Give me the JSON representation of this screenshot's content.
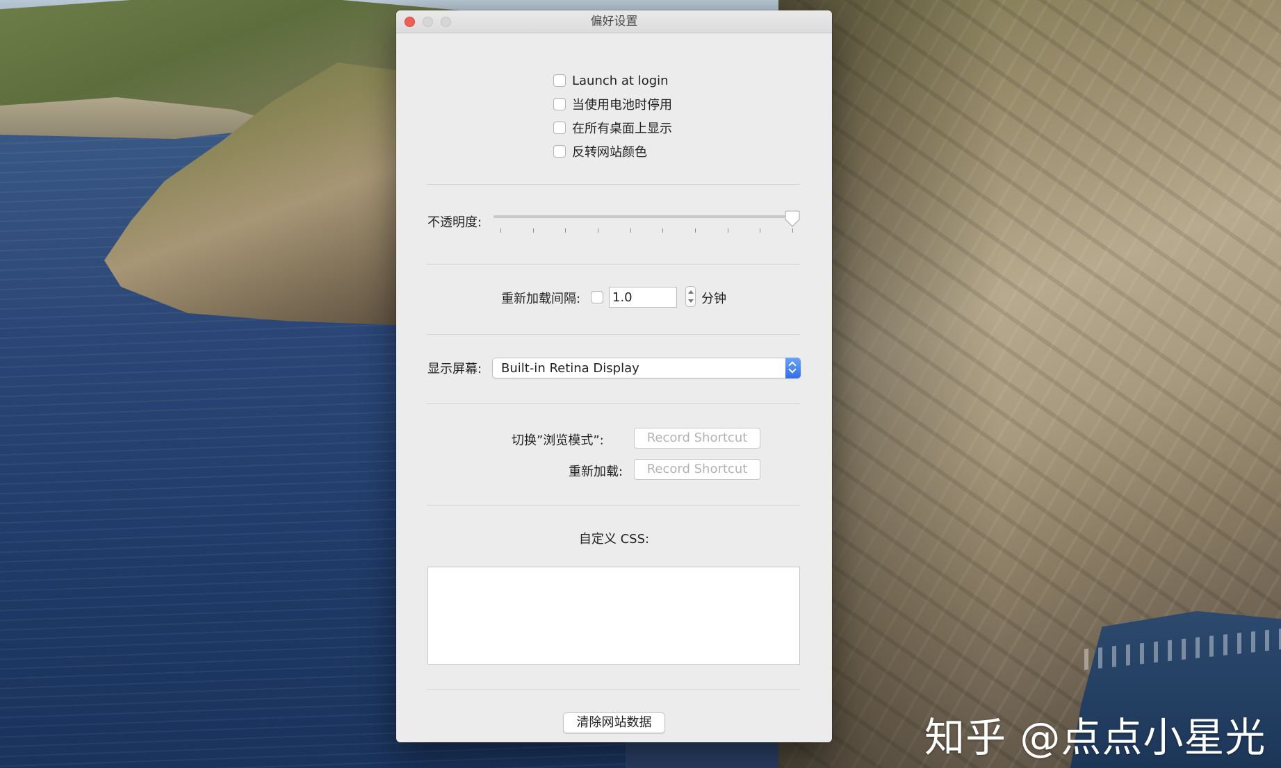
{
  "window": {
    "title": "偏好设置"
  },
  "general": {
    "checkboxes": [
      {
        "label": "Launch at login",
        "checked": false
      },
      {
        "label": "当使用电池时停用",
        "checked": false
      },
      {
        "label": "在所有桌面上显示",
        "checked": false
      },
      {
        "label": "反转网站颜色",
        "checked": false
      }
    ]
  },
  "opacity": {
    "label": "不透明度:",
    "value": 1.0,
    "tick_count": 10
  },
  "reload_interval": {
    "label": "重新加载间隔:",
    "enabled": false,
    "value": "1.0",
    "unit": "分钟"
  },
  "display": {
    "label": "显示屏幕:",
    "selected": "Built-in Retina Display",
    "accent_color": "#2f6ee8"
  },
  "shortcuts": {
    "toggle_browse_label": "切换”浏览模式”:",
    "toggle_browse_button": "Record Shortcut",
    "reload_label": "重新加载:",
    "reload_button": "Record Shortcut"
  },
  "custom_css": {
    "label": "自定义 CSS:",
    "value": ""
  },
  "clear_data": {
    "button": "清除网站数据"
  },
  "watermark": {
    "text": "知乎 @点点小星光"
  }
}
